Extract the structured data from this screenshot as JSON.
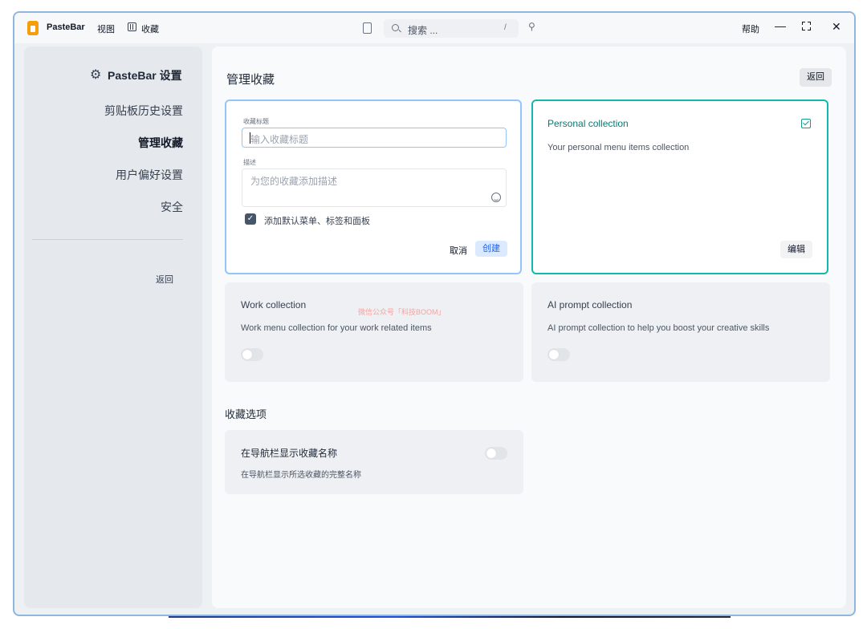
{
  "titlebar": {
    "app_name": "PasteBar",
    "menu_view": "视图",
    "menu_collections": "收藏",
    "search_placeholder": "搜索 ...",
    "search_shortcut": "/",
    "pin_glyph": "⚲",
    "help": "帮助",
    "minimize_glyph": "—",
    "close_glyph": "✕"
  },
  "sidebar": {
    "title": "PasteBar 设置",
    "items": [
      {
        "label": "剪贴板历史设置",
        "active": false
      },
      {
        "label": "管理收藏",
        "active": true
      },
      {
        "label": "用户偏好设置",
        "active": false
      },
      {
        "label": "安全",
        "active": false
      }
    ],
    "back": "返回"
  },
  "main": {
    "title": "管理收藏",
    "back": "返回",
    "new_collection_form": {
      "title_label": "收藏标题",
      "title_placeholder": "输入收藏标题",
      "description_label": "描述",
      "description_placeholder": "为您的收藏添加描述",
      "add_defaults_label": "添加默认菜单、标签和面板",
      "add_defaults_checked": true,
      "cancel": "取消",
      "create": "创建"
    },
    "collections": [
      {
        "title": "Personal collection",
        "description": "Your personal menu items collection",
        "selected": true,
        "edit_label": "编辑"
      },
      {
        "title": "Work collection",
        "description": "Work menu collection for your work related items",
        "enabled": false
      },
      {
        "title": "AI prompt collection",
        "description": "AI prompt collection to help you boost your creative skills",
        "enabled": false
      }
    ],
    "watermark": "微信公众号「科技BOOM」",
    "options_section": {
      "title": "收藏选项",
      "option_title": "在导航栏显示收藏名称",
      "option_description": "在导航栏显示所选收藏的完整名称",
      "option_enabled": false
    }
  },
  "colors": {
    "accent_blue": "#93c5fd",
    "selected_teal": "#14b8a6",
    "create_button_text": "#2563eb",
    "app_logo": "#f59e0b"
  }
}
